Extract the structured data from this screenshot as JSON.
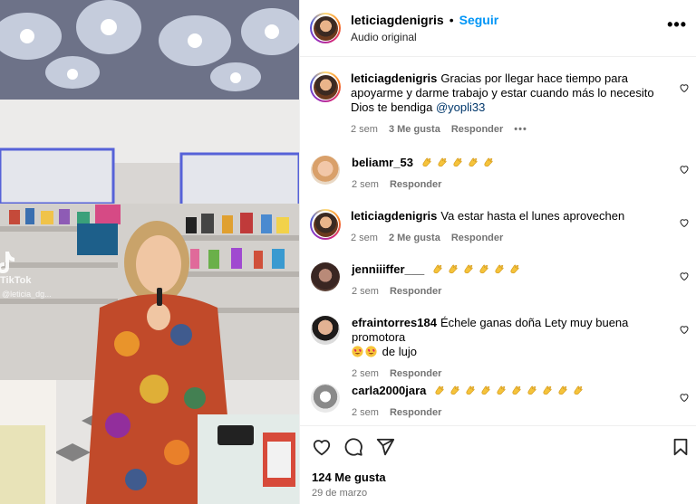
{
  "post": {
    "username": "leticiagdenigris",
    "separator": "•",
    "follow_label": "Seguir",
    "audio": "Audio original",
    "more_label": "•••"
  },
  "media": {
    "watermark_brand": "TikTok",
    "watermark_user": "@leticia_dg..."
  },
  "comments": [
    {
      "username": "leticiagdenigris",
      "text": "Gracias por llegar hace tiempo para apoyarme y darme trabajo y estar cuando más lo necesito Dios te bendiga",
      "mention": "@yopli33",
      "time": "2 sem",
      "likes": "3 Me gusta",
      "reply": "Responder",
      "more": "•••"
    },
    {
      "username": "beliamr_53",
      "emoji": [
        "clapping-hands",
        "clapping-hands",
        "clapping-hands",
        "clapping-hands",
        "clapping-hands"
      ],
      "time": "2 sem",
      "reply": "Responder"
    },
    {
      "username": "leticiagdenigris",
      "text": "Va estar hasta el lunes aprovechen",
      "time": "2 sem",
      "likes": "2 Me gusta",
      "reply": "Responder"
    },
    {
      "username": "jenniiiffer___",
      "emoji": [
        "clapping-hands",
        "clapping-hands",
        "clapping-hands",
        "clapping-hands",
        "clapping-hands",
        "clapping-hands"
      ],
      "time": "2 sem",
      "reply": "Responder"
    },
    {
      "username": "efraintorres184",
      "text": "Échele ganas doña Lety muy buena promotora",
      "text_after": "de lujo",
      "emoji": [
        "heart-eyes",
        "heart-eyes"
      ],
      "time": "2 sem",
      "reply": "Responder"
    },
    {
      "username": "carla2000jara",
      "emoji": [
        "clapping-hands",
        "clapping-hands",
        "clapping-hands",
        "clapping-hands",
        "clapping-hands",
        "clapping-hands",
        "clapping-hands",
        "clapping-hands",
        "clapping-hands",
        "clapping-hands"
      ],
      "time": "2 sem",
      "reply": "Responder"
    }
  ],
  "footer": {
    "likes": "124 Me gusta",
    "date": "29 de marzo"
  },
  "colors": {
    "follow": "#0095f6",
    "mention": "#00376b",
    "meta": "#737373"
  }
}
